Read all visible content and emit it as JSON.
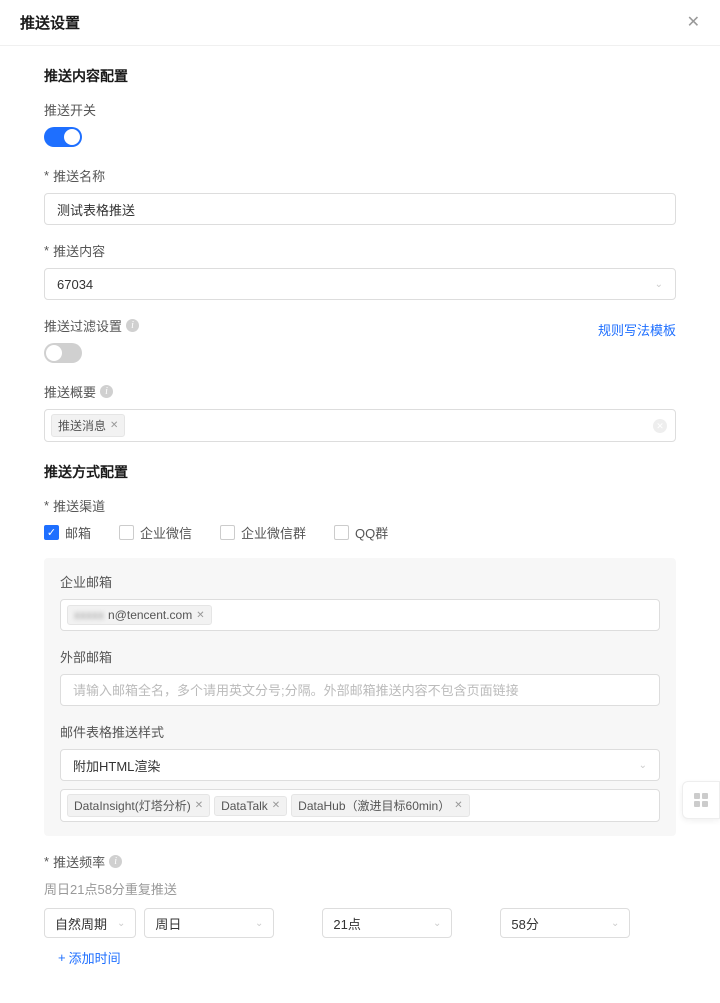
{
  "header": {
    "title": "推送设置"
  },
  "content_config": {
    "section_title": "推送内容配置",
    "toggle_label": "推送开关",
    "name_label": "推送名称",
    "name_value": "测试表格推送",
    "push_content_label": "推送内容",
    "push_content_value": "67034",
    "filter_label": "推送过滤设置",
    "filter_link": "规则写法模板",
    "summary_label": "推送概要",
    "summary_tag": "推送消息"
  },
  "method_config": {
    "section_title": "推送方式配置",
    "channel_label": "推送渠道",
    "channels": {
      "email": "邮箱",
      "wecom": "企业微信",
      "wecom_group": "企业微信群",
      "qq_group": "QQ群"
    },
    "corp_email_label": "企业邮箱",
    "corp_email_tag_prefix": "xxxxx",
    "corp_email_tag_suffix": "n@tencent.com",
    "ext_email_label": "外部邮箱",
    "ext_email_placeholder": "请输入邮箱全名，多个请用英文分号;分隔。外部邮箱推送内容不包含页面链接",
    "style_label": "邮件表格推送样式",
    "style_value": "附加HTML渲染",
    "style_tags": [
      "DataInsight(灯塔分析)",
      "DataTalk",
      "DataHub（激进目标60min）"
    ]
  },
  "frequency": {
    "label": "推送频率",
    "desc": "周日21点58分重复推送",
    "period_type": "自然周期",
    "period_value": "周日",
    "hour_value": "21点",
    "minute_value": "58分",
    "add_time": "添加时间"
  }
}
